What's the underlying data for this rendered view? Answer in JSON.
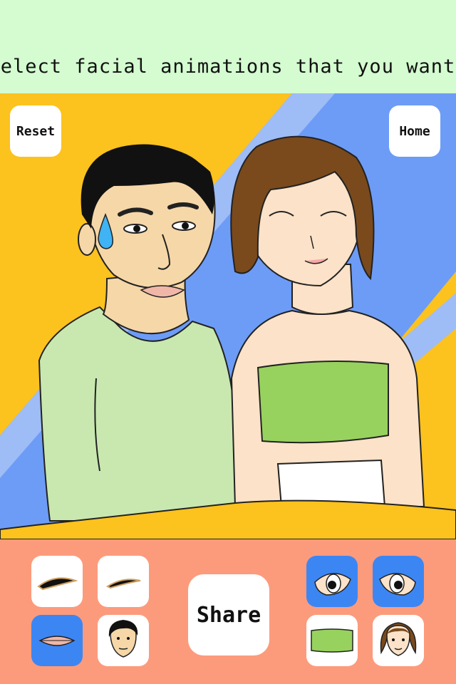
{
  "header": {
    "instruction": "Select facial animations that you want."
  },
  "buttons": {
    "reset_label": "Reset",
    "home_label": "Home",
    "share_label": "Share"
  },
  "colors": {
    "header_bg": "#d4fcd0",
    "toolbar_bg": "#fc9b7c",
    "selected_tile": "#3c86f4",
    "scene_yellow": "#fcc21e",
    "scene_blue": "#6d9cf7"
  },
  "toolbar": {
    "left_tiles": [
      {
        "icon": "eyebrow-thick-icon",
        "selected": false
      },
      {
        "icon": "eyebrow-thin-icon",
        "selected": false
      },
      {
        "icon": "lips-icon",
        "selected": true
      },
      {
        "icon": "man-face-icon",
        "selected": false
      }
    ],
    "right_tiles": [
      {
        "icon": "eye-left-icon",
        "selected": true
      },
      {
        "icon": "eye-right-icon",
        "selected": true
      },
      {
        "icon": "green-top-icon",
        "selected": false
      },
      {
        "icon": "woman-face-icon",
        "selected": false
      }
    ]
  }
}
